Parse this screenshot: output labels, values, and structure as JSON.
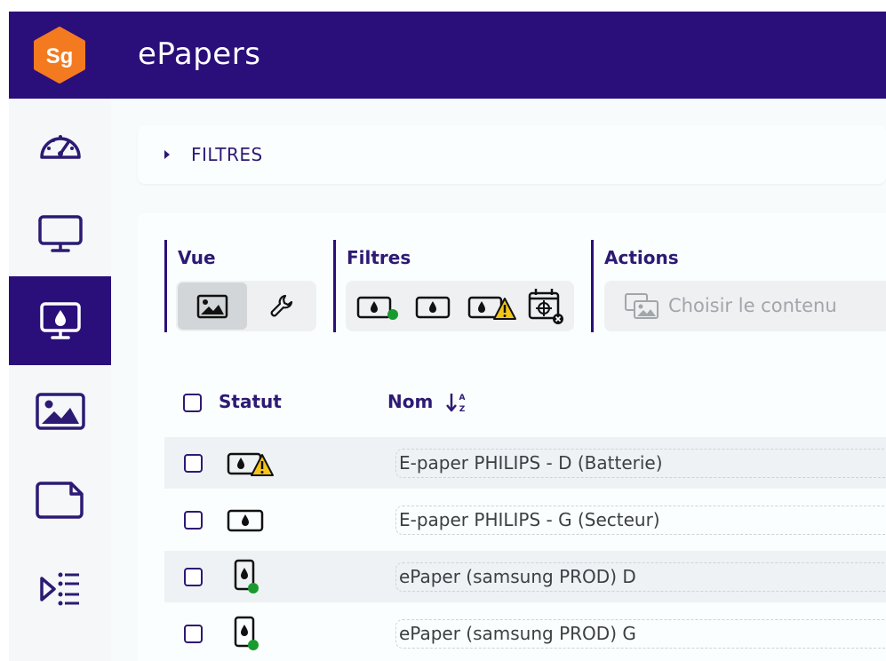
{
  "app": {
    "logo_text": "Sg",
    "title": "ePapers"
  },
  "colors": {
    "brand": "#2a0f7a",
    "logo": "#f47a20",
    "status_ok": "#1a9a2e",
    "warning": "#f5c518"
  },
  "sidebar": {
    "items": [
      {
        "icon": "dashboard-gauge-icon",
        "active": false
      },
      {
        "icon": "monitor-icon",
        "active": false
      },
      {
        "icon": "epaper-monitor-icon",
        "active": true
      },
      {
        "icon": "image-icon",
        "active": false
      },
      {
        "icon": "page-icon",
        "active": false
      },
      {
        "icon": "playlist-icon",
        "active": false
      }
    ]
  },
  "filters_bar": {
    "label": "FILTRES",
    "expanded": false
  },
  "toolbar": {
    "vue": {
      "label": "Vue",
      "buttons": [
        {
          "icon": "image-view-icon",
          "active": true
        },
        {
          "icon": "wrench-icon",
          "active": false
        }
      ]
    },
    "filtres": {
      "label": "Filtres",
      "buttons": [
        {
          "icon": "epaper-online-icon"
        },
        {
          "icon": "epaper-icon"
        },
        {
          "icon": "epaper-warning-icon"
        },
        {
          "icon": "calendar-target-icon"
        }
      ]
    },
    "actions": {
      "label": "Actions",
      "choose_label": "Choisir le contenu"
    }
  },
  "table": {
    "columns": {
      "status": "Statut",
      "name": "Nom",
      "sort_icon": "sort-alpha-asc-icon"
    },
    "rows": [
      {
        "status_icon": "epaper-landscape-warning-icon",
        "name": "E-paper PHILIPS - D (Batterie)"
      },
      {
        "status_icon": "epaper-landscape-icon",
        "name": "E-paper PHILIPS - G (Secteur)"
      },
      {
        "status_icon": "epaper-portrait-online-icon",
        "name": "ePaper (samsung PROD) D"
      },
      {
        "status_icon": "epaper-portrait-online-icon",
        "name": "ePaper (samsung PROD) G"
      }
    ]
  }
}
